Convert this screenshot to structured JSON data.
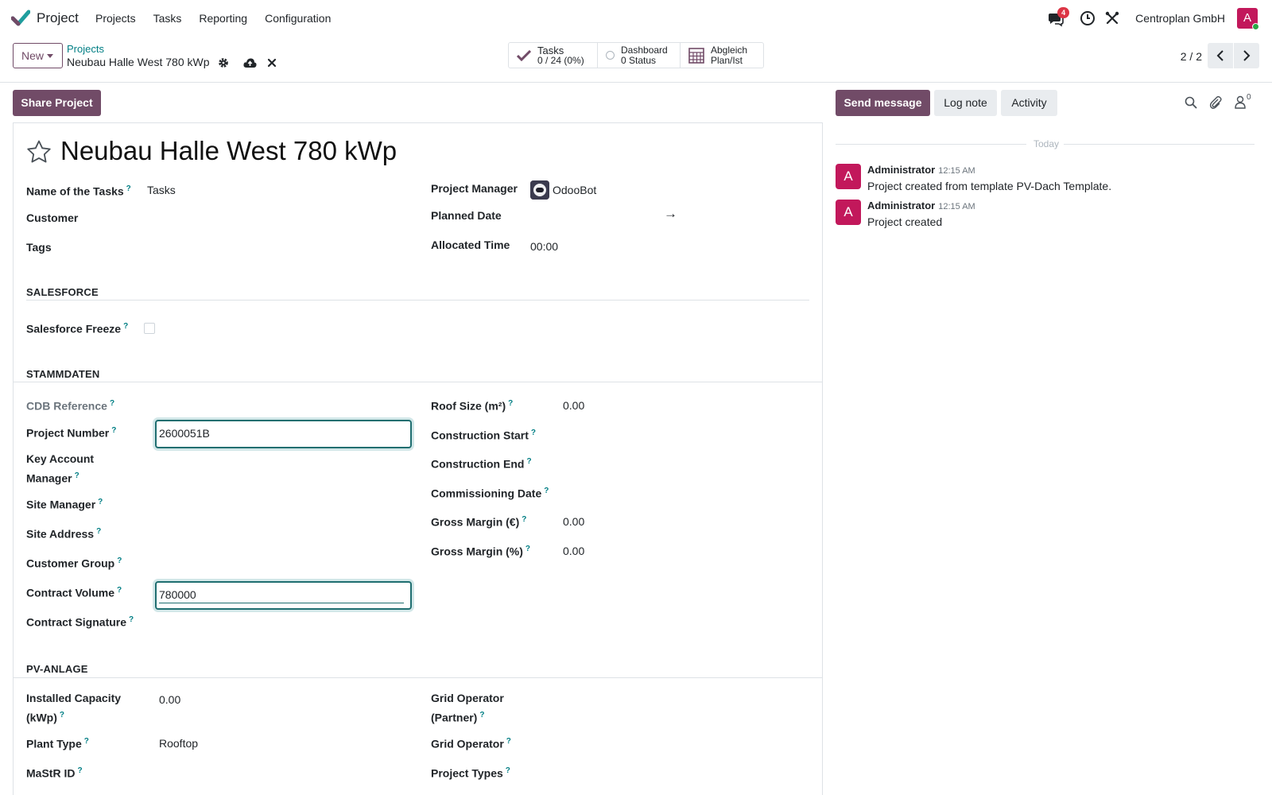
{
  "nav": {
    "app_name": "Project",
    "menu": [
      "Projects",
      "Tasks",
      "Reporting",
      "Configuration"
    ],
    "message_count": "4",
    "company": "Centroplan GmbH",
    "user_initial": "A"
  },
  "control": {
    "new_label": "New",
    "breadcrumb_parent": "Projects",
    "breadcrumb_current": "Neubau Halle West 780 kWp",
    "smart_buttons": {
      "tasks": {
        "title": "Tasks",
        "value": "0 / 24 (0%)"
      },
      "dashboard": {
        "title": "Dashboard",
        "value": "0 Status"
      },
      "abgleich": {
        "title": "Abgleich",
        "value": "Plan/Ist"
      }
    },
    "pager": "2 / 2"
  },
  "form": {
    "share_label": "Share Project",
    "title": "Neubau Halle West 780 kWp",
    "fields": {
      "name_tasks": {
        "label": "Name of the Tasks",
        "value": "Tasks",
        "help": "?"
      },
      "customer": {
        "label": "Customer"
      },
      "tags": {
        "label": "Tags"
      },
      "project_manager": {
        "label": "Project Manager",
        "value": "OdooBot"
      },
      "planned_date": {
        "label": "Planned Date",
        "arrow": "→"
      },
      "allocated_time": {
        "label": "Allocated Time",
        "value": "00:00"
      }
    },
    "salesforce": {
      "heading": "SALESFORCE",
      "freeze_label": "Salesforce Freeze",
      "help": "?"
    },
    "stammdaten": {
      "heading": "STAMMDATEN",
      "cdb_reference": "CDB Reference",
      "project_number": {
        "label": "Project Number",
        "value": "2600051B"
      },
      "key_account_manager_1": "Key Account",
      "key_account_manager_2": "Manager",
      "site_manager": "Site Manager",
      "site_address": "Site Address",
      "customer_group": "Customer Group",
      "contract_volume": {
        "label": "Contract Volume",
        "value": "780000"
      },
      "contract_signature": "Contract Signature",
      "roof_size": {
        "label": "Roof Size (m²)",
        "value": "0.00"
      },
      "construction_start": "Construction Start",
      "construction_end": "Construction End",
      "commissioning_date": "Commissioning Date",
      "gross_margin_eur": {
        "label": "Gross Margin (€)",
        "value": "0.00"
      },
      "gross_margin_pct": {
        "label": "Gross Margin (%)",
        "value": "0.00"
      },
      "help": "?"
    },
    "pv_anlage": {
      "heading": "PV-ANLAGE",
      "installed_capacity_1": "Installed Capacity",
      "installed_capacity_2": "(kWp)",
      "installed_capacity_value": "0.00",
      "plant_type": {
        "label": "Plant Type",
        "value": "Rooftop"
      },
      "mastr_id": "MaStR ID",
      "grid_operator_partner_1": "Grid Operator",
      "grid_operator_partner_2": "(Partner)",
      "grid_operator": "Grid Operator",
      "project_types": "Project Types",
      "help": "?"
    }
  },
  "chatter": {
    "send_message": "Send message",
    "log_note": "Log note",
    "activity": "Activity",
    "followers_count": "0",
    "today": "Today",
    "messages": [
      {
        "author": "Administrator",
        "time": "12:15 AM",
        "body": "Project created from template PV-Dach Template.",
        "initial": "A"
      },
      {
        "author": "Administrator",
        "time": "12:15 AM",
        "body": "Project created",
        "initial": "A"
      }
    ]
  },
  "colors": {
    "brand": "#714b67",
    "link": "#017e84",
    "avatar": "#c2185b",
    "focus": "#1f6e70"
  }
}
